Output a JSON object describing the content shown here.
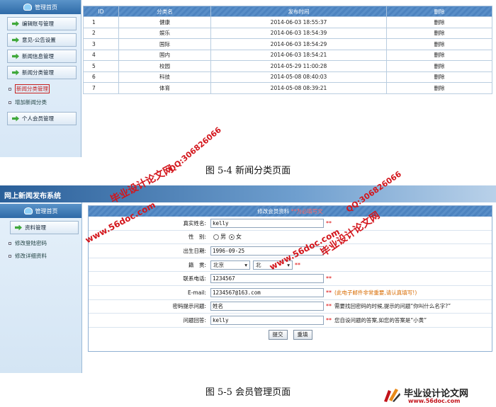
{
  "fig1": {
    "sidebar": {
      "home": "管理首页",
      "buttons": [
        "编辑账号管理",
        "意见-公告设置",
        "新闻信息管理",
        "新闻分类管理"
      ],
      "subs": [
        "新闻分类管理",
        "增加新闻分类"
      ],
      "member_btn": "个人会员管理"
    },
    "table": {
      "headers": [
        "ID",
        "分类名",
        "发布时间",
        "删除"
      ],
      "rows": [
        [
          "1",
          "健康",
          "2014-06-03 18:55:37",
          "删除"
        ],
        [
          "2",
          "娱乐",
          "2014-06-03 18:54:39",
          "删除"
        ],
        [
          "3",
          "国际",
          "2014-06-03 18:54:29",
          "删除"
        ],
        [
          "4",
          "国内",
          "2014-06-03 18:54:21",
          "删除"
        ],
        [
          "5",
          "校园",
          "2014-05-29 11:00:28",
          "删除"
        ],
        [
          "6",
          "科技",
          "2014-05-08 08:40:03",
          "删除"
        ],
        [
          "7",
          "体育",
          "2014-05-08 08:39:21",
          "删除"
        ]
      ]
    },
    "caption": "图 5-4 新闻分类页面"
  },
  "fig2": {
    "banner_title": "网上新闻发布系统",
    "sidebar": {
      "home": "管理首页",
      "button": "资料管理",
      "subs": [
        "修改登陆密码",
        "修改详细资料"
      ]
    },
    "form": {
      "title": "修改会员资料",
      "title_req": "**为必填写文",
      "name_label": "真实姓名:",
      "name_value": "kelly",
      "gender_label": "性　别:",
      "gender_male": "男",
      "gender_female": "女",
      "birth_label": "出生日期:",
      "birth_value": "1996-09-25",
      "native_label": "籍　贯:",
      "native_province": "北京",
      "native_city": "北",
      "phone_label": "联系电话:",
      "phone_value": "1234567",
      "email_label": "E-mail:",
      "email_value": "1234567@163.com",
      "email_hint": "(此电子邮件非常重要,请认真填写!)",
      "question_label": "密码提示问题:",
      "question_value": "姓名",
      "question_hint": "需要找回密码的时候,提示的问题“你叫什么名字?”",
      "answer_label": "问题回答:",
      "answer_value": "kelly",
      "answer_hint": "您自设问题的答案,如您的答案是“小黄”",
      "submit": "提交",
      "reset": "重填",
      "stars": "**"
    },
    "caption": "图 5-5 会员管理页面"
  },
  "watermarks": {
    "cn": "毕业设计论文网",
    "url": "www.56doc.com",
    "qq": "QQ:306826066"
  },
  "logo": {
    "cn": "毕业设计论文网",
    "url": "www.56doc.com"
  },
  "colors": {
    "watermark": "#d3151b",
    "header_blue": "#5a8fc8"
  }
}
